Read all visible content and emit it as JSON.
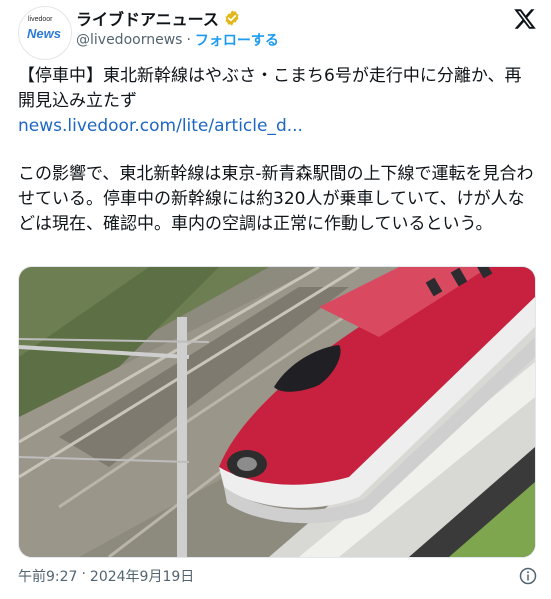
{
  "account": {
    "avatar_small_text": "livedoor",
    "avatar_large_text": "News",
    "display_name": "ライブドアニュース",
    "handle": "@livedoornews",
    "separator": "·",
    "follow_label": "フォローする"
  },
  "post": {
    "headline": "【停車中】東北新幹線はやぶさ・こまち6号が走行中に分離か、再開見込み立たず",
    "link_text": "news.livedoor.com/lite/article_d...",
    "body": "この影響で、東北新幹線は東京-新青森駅間の上下線で運転を見合わせている。停車中の新幹線には約320人が乗車していて、けが人などは現在、確認中。車内の空調は正常に作動しているという。"
  },
  "meta": {
    "time": "午前9:27",
    "separator": "·",
    "date": "2024年9月19日"
  },
  "colors": {
    "verified_gold": "#e2b719",
    "follow_blue": "#1d9bf0",
    "link_blue": "#1d66c4",
    "train_red": "#c8213f"
  },
  "icons": [
    "verified-badge-icon",
    "x-logo-icon",
    "info-icon"
  ]
}
